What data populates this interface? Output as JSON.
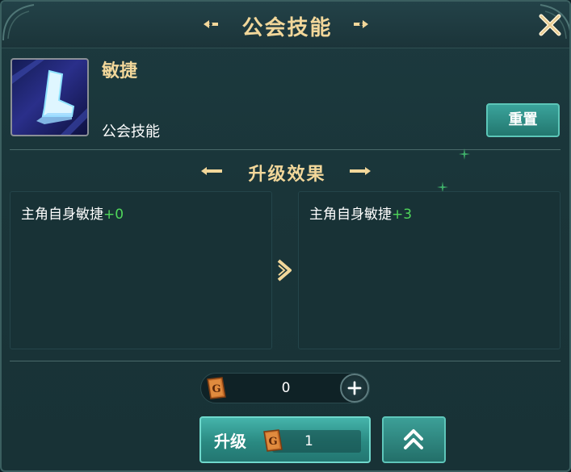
{
  "window": {
    "title": "公会技能",
    "close_icon": "close-icon"
  },
  "skill": {
    "name": "敏捷",
    "type": "公会技能",
    "icon": "boot-icon",
    "reset_label": "重置"
  },
  "upgrade_effect": {
    "title": "升级效果",
    "current": {
      "stat": "主角自身敏捷",
      "value": "+0"
    },
    "next": {
      "stat": "主角自身敏捷",
      "value": "+3"
    },
    "arrow_icon": "chevron-right-icon"
  },
  "resource": {
    "icon": "guild-book-icon",
    "amount": "0",
    "add_icon": "plus-icon"
  },
  "actions": {
    "upgrade_label": "升级",
    "upgrade_cost": "1",
    "max_icon": "double-chevron-up-icon"
  },
  "colors": {
    "gold": "#f2d79a",
    "teal_button": "#2a8a82",
    "bonus_green": "#4fd65a",
    "panel_bg": "#1a3539"
  }
}
